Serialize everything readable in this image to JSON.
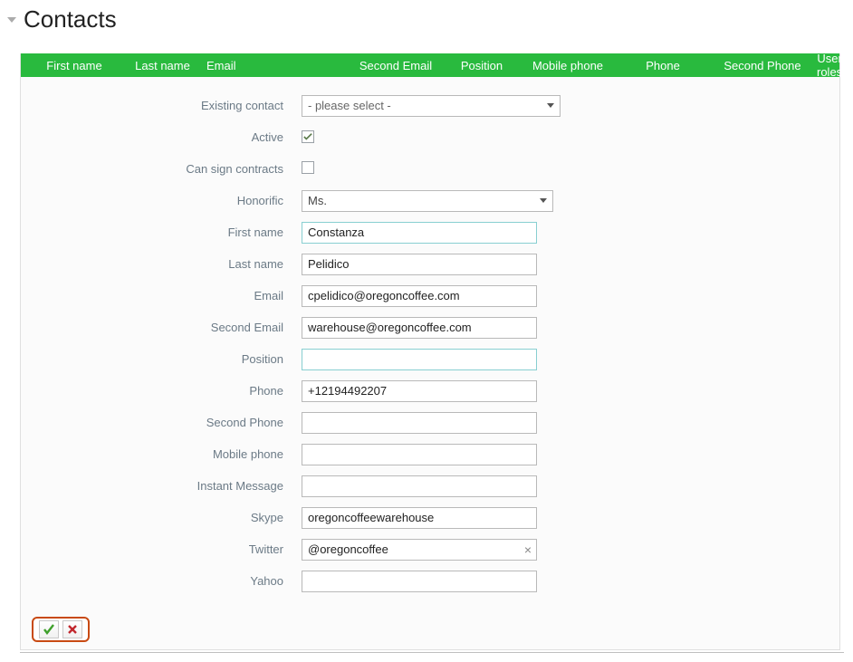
{
  "page": {
    "title": "Contacts"
  },
  "table_header": {
    "first": "First name",
    "last": "Last name",
    "email": "Email",
    "second_email": "Second Email",
    "position": "Position",
    "mobile": "Mobile phone",
    "phone": "Phone",
    "second_phone": "Second Phone",
    "roles": "User roles"
  },
  "form": {
    "existing_contact": {
      "label": "Existing contact",
      "value": "- please select -"
    },
    "active": {
      "label": "Active",
      "checked": true
    },
    "can_sign": {
      "label": "Can sign contracts",
      "checked": false
    },
    "honorific": {
      "label": "Honorific",
      "value": "Ms."
    },
    "first_name": {
      "label": "First name",
      "value": "Constanza"
    },
    "last_name": {
      "label": "Last name",
      "value": "Pelidico"
    },
    "email": {
      "label": "Email",
      "value": "cpelidico@oregoncoffee.com"
    },
    "second_email": {
      "label": "Second Email",
      "value": "warehouse@oregoncoffee.com"
    },
    "position": {
      "label": "Position",
      "value": ""
    },
    "phone": {
      "label": "Phone",
      "value": "+12194492207"
    },
    "second_phone": {
      "label": "Second Phone",
      "value": ""
    },
    "mobile_phone": {
      "label": "Mobile phone",
      "value": ""
    },
    "instant_message": {
      "label": "Instant Message",
      "value": ""
    },
    "skype": {
      "label": "Skype",
      "value": "oregoncoffeewarehouse"
    },
    "twitter": {
      "label": "Twitter",
      "value": "@oregoncoffee"
    },
    "yahoo": {
      "label": "Yahoo",
      "value": ""
    }
  },
  "footer": {
    "confirm": "confirm",
    "cancel": "cancel"
  }
}
